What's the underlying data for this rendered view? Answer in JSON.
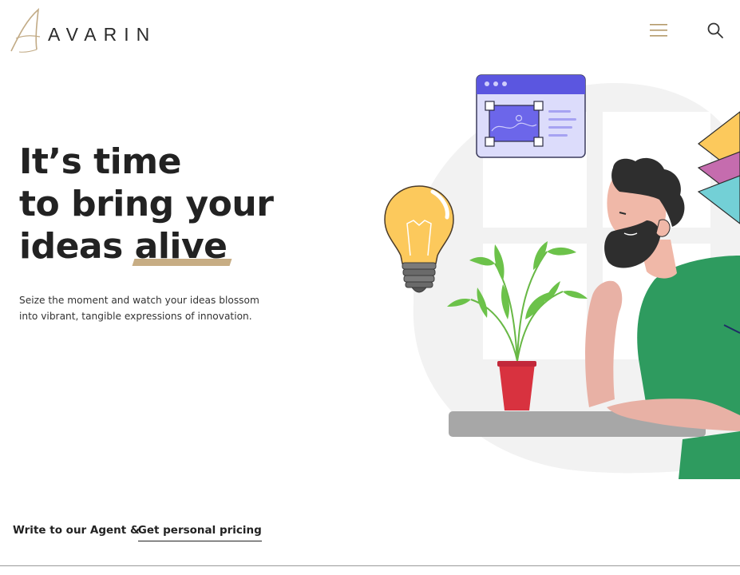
{
  "header": {
    "brand": "AVARIN",
    "icons": {
      "logo": "logo-a-mark-icon",
      "menu": "hamburger-menu-icon",
      "search": "search-icon"
    }
  },
  "hero": {
    "title_line1": "It’s time",
    "title_line2": "to bring your",
    "title_line3_a": "ideas ",
    "title_line3_b": "alive",
    "subtitle": "Seize the moment and watch your ideas blossom into vibrant, tangible expressions of innovation."
  },
  "cta": {
    "prefix": "Write to our Agent &",
    "link": "Get personal pricing"
  },
  "colors": {
    "accent": "#c7ad84",
    "menu_icon": "#b49a6a",
    "text": "#222222",
    "shirt": "#2e9b5f",
    "ui_window": "#5b56e0",
    "pot": "#d8323f",
    "bulb": "#fcc95c"
  }
}
